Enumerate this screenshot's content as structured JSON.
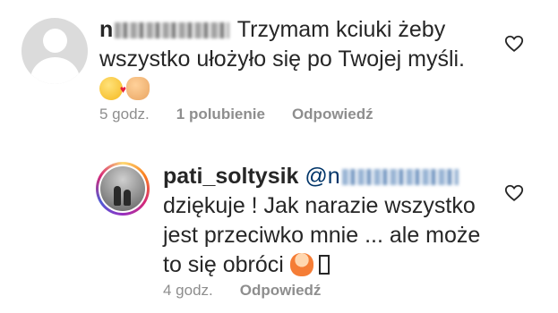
{
  "comments": [
    {
      "username": "n",
      "text": " Trzymam kciuki żeby wszystko ułożyło się po Twojej myśli.",
      "emoji": [
        "kiss-emoji",
        "fist-emoji"
      ],
      "time": "5 godz.",
      "likes": "1 polubienie",
      "reply": "Odpowiedź"
    },
    {
      "username": "pati_soltysik",
      "mention": "@n",
      "text": "dziękuje ! Jak narazie wszystko jest przeciwko mnie ... ale może to się obróci",
      "emoji": [
        "person-emoji"
      ],
      "time": "4 godz.",
      "reply": "Odpowiedź"
    }
  ]
}
